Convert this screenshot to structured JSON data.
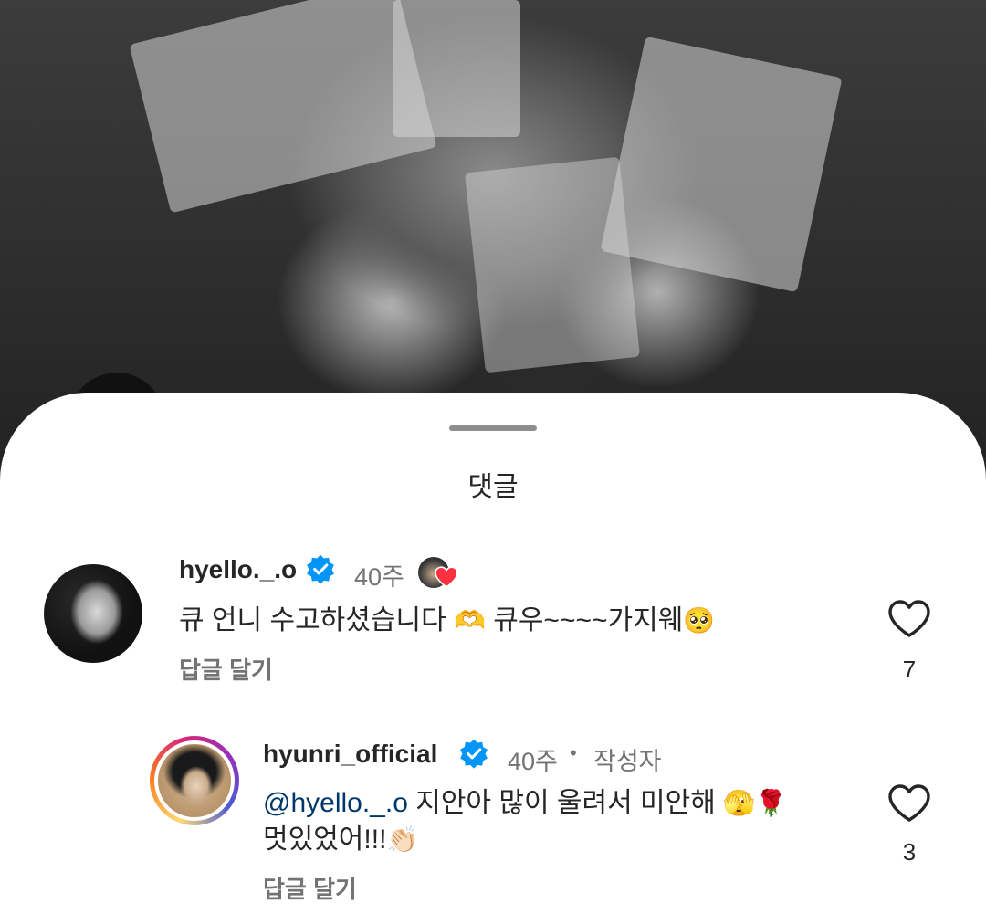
{
  "sheet": {
    "title": "댓글"
  },
  "comments": [
    {
      "username": "hyello._.o",
      "time": "40주",
      "text_before": "큐 언니 수고하셨습니다 ",
      "emoji_1": "🫶",
      "text_after": " 큐우~~~~가지웨",
      "emoji_2": "🥺",
      "reply_label": "답글 달기",
      "like_count": "7",
      "verified": true,
      "liked_by_author": true
    },
    {
      "username": "hyunri_official",
      "time": "40주",
      "separator": "•",
      "author_badge": "작성자",
      "mention": "@hyello._.o",
      "line1_text": " 지안아 많이 울려서 미안해 ",
      "emoji_1": "🫣",
      "emoji_2": "🌹",
      "line2_text": "멋있었어!!!",
      "emoji_3": "👏🏻",
      "reply_label": "답글 달기",
      "like_count": "3",
      "verified": true
    }
  ],
  "colors": {
    "verified_blue": "#0095f6",
    "like_heart": "#ff3040",
    "mention": "#00376b",
    "muted_text": "#737373"
  },
  "icons": {
    "verified": "verified-badge-icon",
    "like": "heart-outline-icon",
    "author_like": "heart-filled-icon"
  }
}
